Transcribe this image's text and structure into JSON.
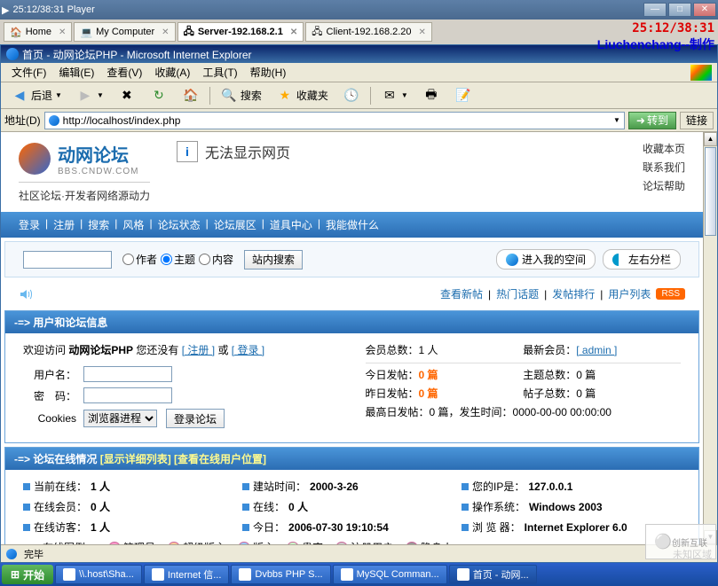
{
  "vm": {
    "title": "25:12/38:31 Player",
    "clock": "25:12/38:31",
    "author": "Liuchenchang--制作"
  },
  "appTabs": [
    {
      "icon": "home",
      "label": "Home",
      "active": false
    },
    {
      "icon": "computer",
      "label": "My Computer",
      "active": false
    },
    {
      "icon": "net",
      "label": "Server-192.168.2.1",
      "active": true
    },
    {
      "icon": "net",
      "label": "Client-192.168.2.20",
      "active": false
    }
  ],
  "ie": {
    "title": "首页 - 动网论坛PHP - Microsoft Internet Explorer",
    "menus": [
      "文件(F)",
      "编辑(E)",
      "查看(V)",
      "收藏(A)",
      "工具(T)",
      "帮助(H)"
    ],
    "back": "后退",
    "search": "搜索",
    "favorites": "收藏夹",
    "addressLabel": "地址(D)",
    "url": "http://localhost/index.php",
    "go": "转到",
    "links": "链接",
    "statusLeft": "完毕",
    "statusRight": "未知区域"
  },
  "page": {
    "logoMain": "动网论坛",
    "logoSub": "BBS.CNDW.COM",
    "logoTag": "社区论坛·开发者网络源动力",
    "errorMsg": "无法显示网页",
    "headerLinks": [
      "收藏本页",
      "联系我们",
      "论坛帮助"
    ],
    "nav": [
      "登录",
      "注册",
      "搜索",
      "风格",
      "论坛状态",
      "论坛展区",
      "道具中心",
      "我能做什么"
    ],
    "searchOptions": {
      "author": "作者",
      "subject": "主题",
      "content": "内容"
    },
    "searchBtn": "站内搜索",
    "mySpace": "进入我的空间",
    "splitView": "左右分栏",
    "subLinks": [
      "查看新帖",
      "热门话题",
      "发帖排行",
      "用户列表"
    ],
    "rss": "RSS",
    "section1": {
      "title": "-=> 用户和论坛信息",
      "welcome": "欢迎访问",
      "forumName": "动网论坛PHP",
      "noAccount": "您还没有",
      "register": "[ 注册 ]",
      "or": "或",
      "login": "[ 登录 ]",
      "userLabel": "用户名：",
      "passLabel": "密　码：",
      "cookiesLabel": "Cookies",
      "cookiesOption": "浏览器进程",
      "loginBtn": "登录论坛",
      "stats": {
        "totalMembers": "会员总数：",
        "totalMembersVal": "1 人",
        "newestMember": "最新会员：",
        "newestMemberVal": "[ admin ]",
        "todayPosts": "今日发帖：",
        "todayPostsVal": "0 篇",
        "totalTopics": "主题总数：",
        "totalTopicsVal": "0 篇",
        "yesterdayPosts": "昨日发帖：",
        "yesterdayPostsVal": "0 篇",
        "totalPosts": "帖子总数：",
        "totalPostsVal": "0 篇",
        "maxDay": "最高日发帖：",
        "maxDayVal": "0 篇，发生时间：0000-00-00 00:00:00"
      }
    },
    "section2": {
      "title": "-=> 论坛在线情况",
      "link1": "[显示详细列表]",
      "link2": "[查看在线用户位置]",
      "currentOnline": "当前在线：",
      "currentOnlineVal": "1 人",
      "createdTime": "建站时间：",
      "createdTimeVal": "2000-3-26",
      "yourIP": "您的IP是：",
      "yourIPVal": "127.0.0.1",
      "onlineMembers": "在线会员：",
      "onlineMembersVal": "0 人",
      "online": "在线：",
      "onlineVal": "0 人",
      "os": "操作系统：",
      "osVal": "Windows 2003",
      "onlineGuests": "在线访客：",
      "onlineGuestsVal": "1 人",
      "today": "今日：",
      "todayVal": "2006-07-30 19:10:54",
      "browser": "浏 览 器：",
      "browserVal": "Internet Explorer 6.0",
      "legend": "在线图例：",
      "roles": [
        "管理员",
        "超级版主",
        "版主",
        "贵宾",
        "注册用户",
        "隐身人"
      ]
    }
  },
  "taskbar": {
    "start": "开始",
    "items": [
      "\\\\.host\\Sha...",
      "Internet 信...",
      "Dvbbs PHP S...",
      "MySQL Comman...",
      "首页 - 动网..."
    ]
  },
  "watermark": "创新互联"
}
